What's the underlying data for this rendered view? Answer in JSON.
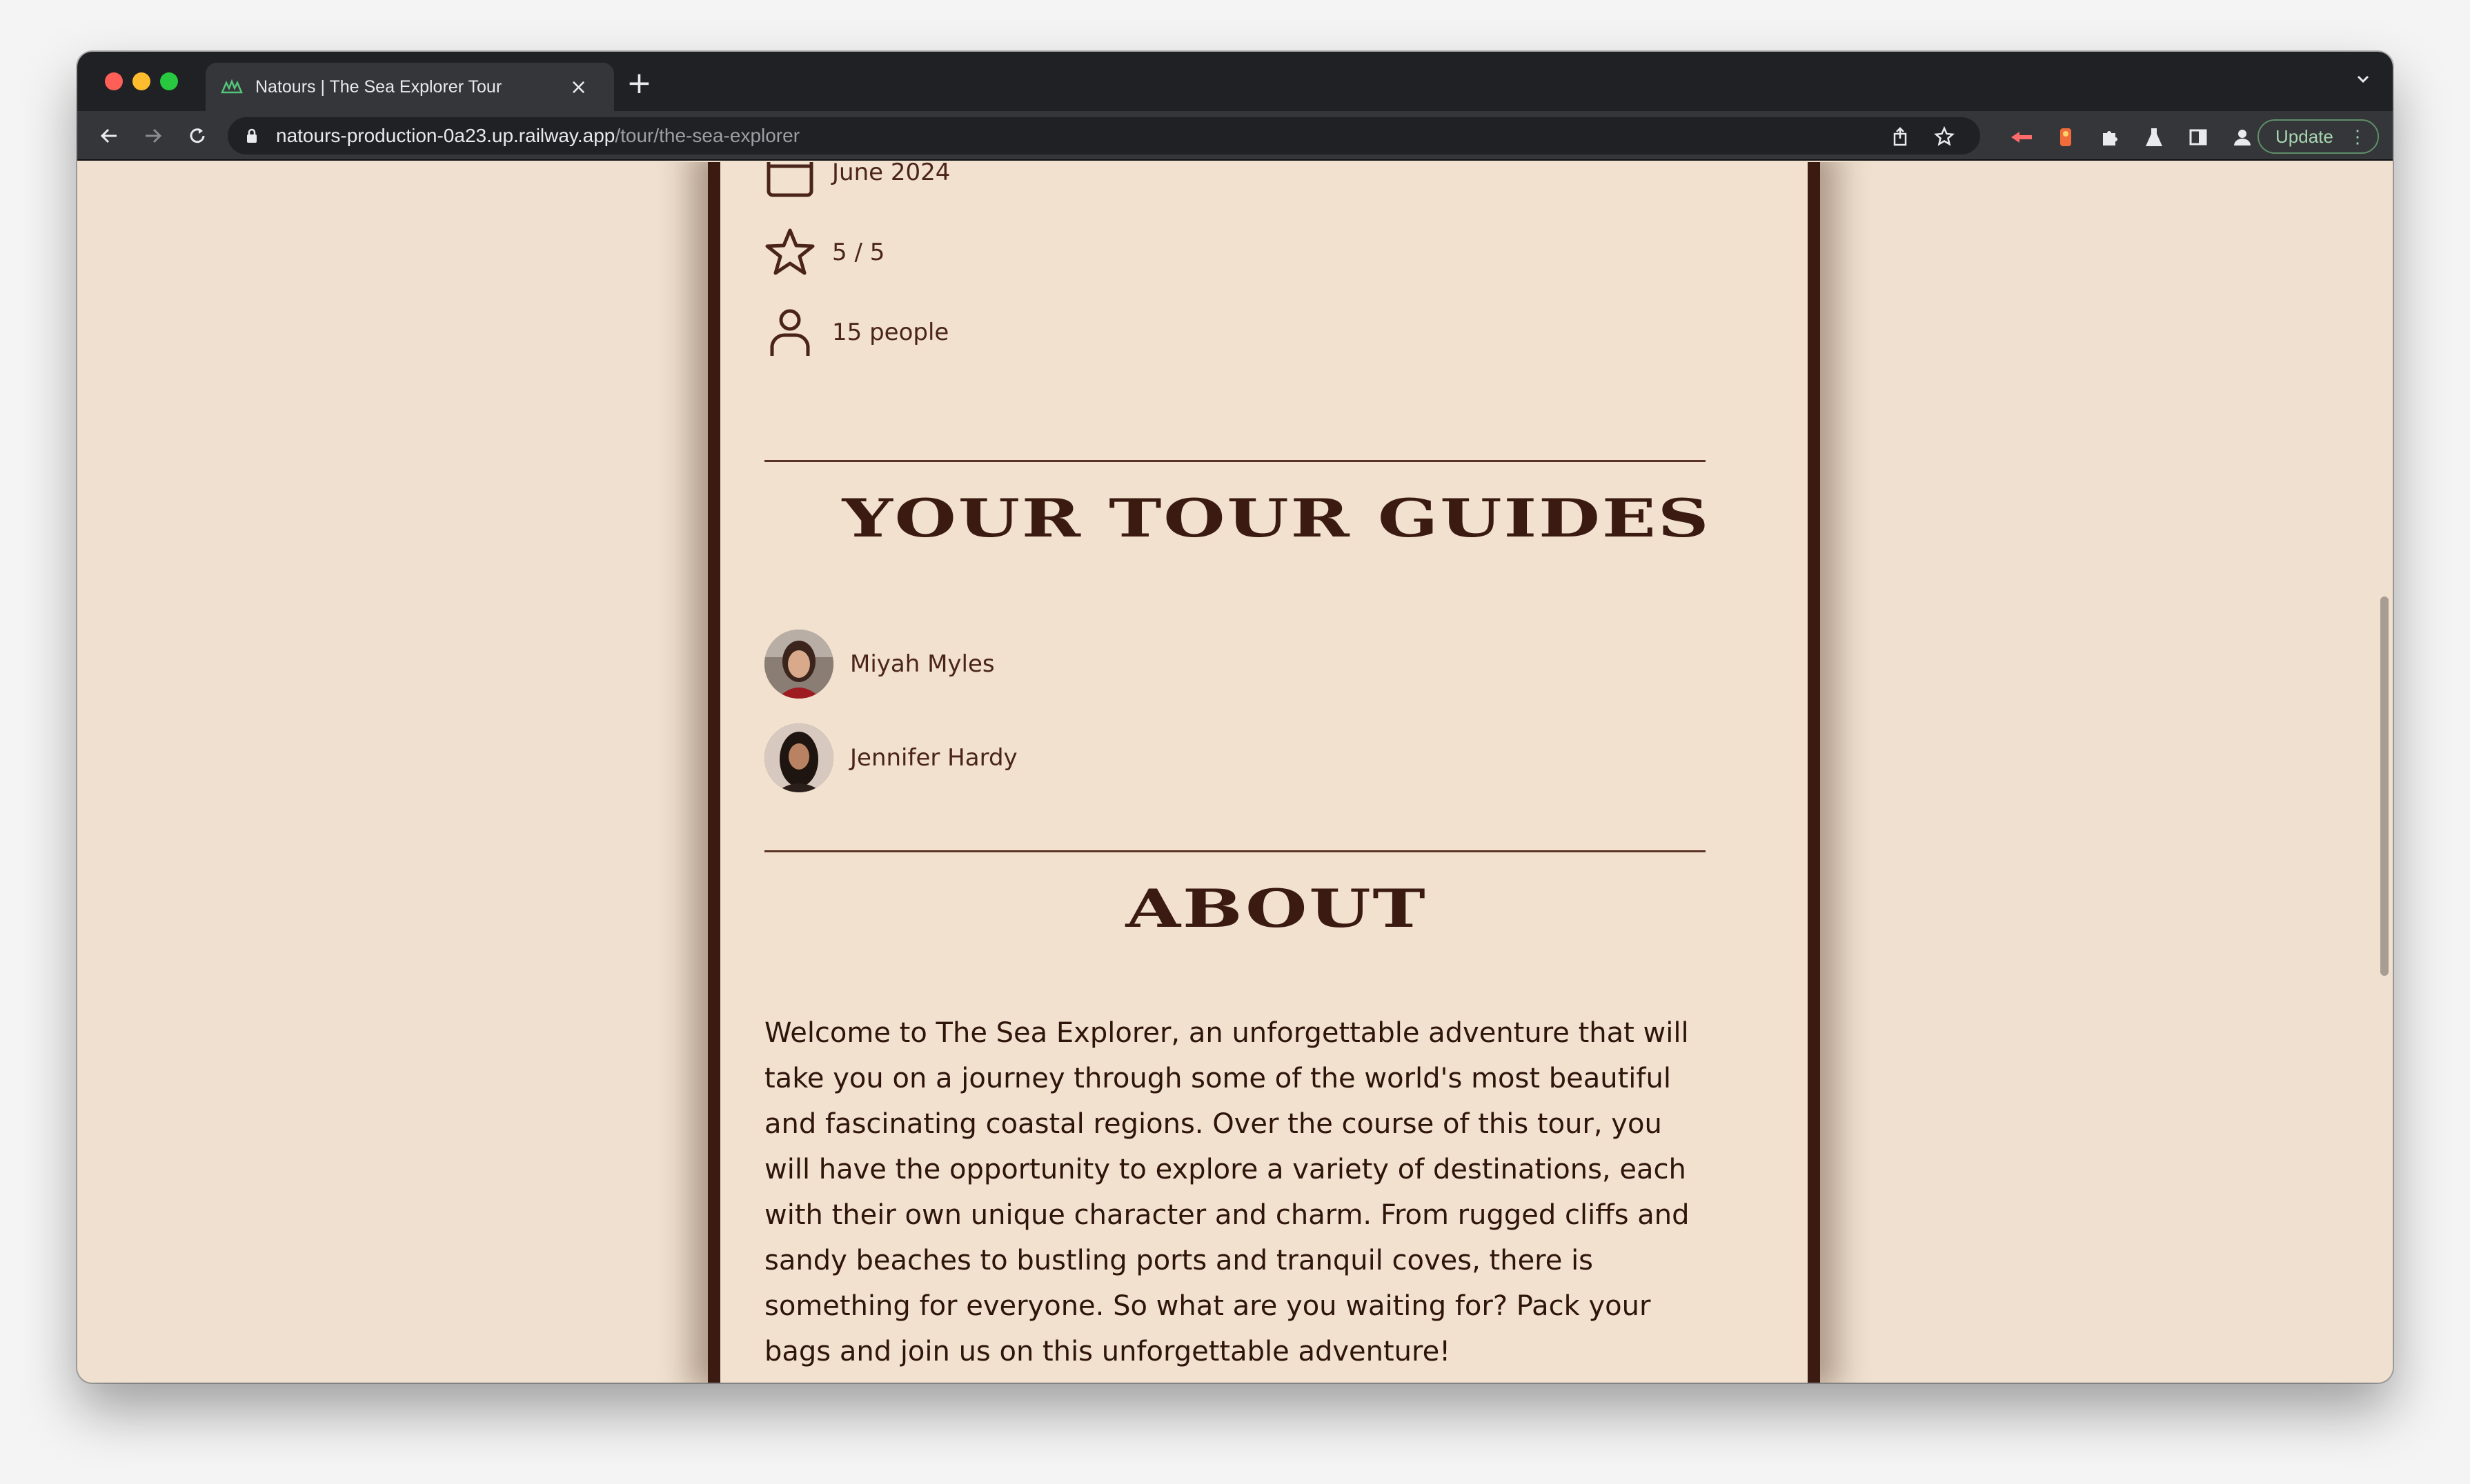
{
  "browser": {
    "tab_title": "Natours | The Sea Explorer Tour",
    "new_tab_label": "+",
    "url_host": "natours-production-0a23.up.railway.app",
    "url_path": "/tour/the-sea-explorer",
    "update_label": "Update",
    "icons": [
      "back-arrow-icon",
      "forward-arrow-icon",
      "reload-icon",
      "lock-icon",
      "share-icon",
      "star-bookmark-icon",
      "extension-icons",
      "puzzle-extensions-icon",
      "flask-icon",
      "sidebar-icon",
      "profile-icon",
      "kebab-menu-icon"
    ]
  },
  "facts": [
    {
      "icon": "calendar-icon",
      "text": "June 2024"
    },
    {
      "icon": "star-icon",
      "text": "5 / 5"
    },
    {
      "icon": "user-icon",
      "text": "15 people"
    }
  ],
  "guides_section": {
    "title": "YOUR TOUR GUIDES",
    "guides": [
      {
        "name": "Miyah Myles"
      },
      {
        "name": "Jennifer Hardy"
      }
    ]
  },
  "about_section": {
    "title": "ABOUT",
    "body": "Welcome to The Sea Explorer, an unforgettable adventure that will take you on a journey through some of the world's most beautiful and fascinating coastal regions. Over the course of this tour, you will have the opportunity to explore a variety of destinations, each with their own unique character and charm. From rugged cliffs and sandy beaches to bustling ports and tranquil coves, there is something for everyone. So what are you waiting for? Pack your bags and join us on this unforgettable adventure!"
  },
  "colors": {
    "page_bg": "#efe0cf",
    "card_border": "#3b1a12",
    "text_dark": "#2f140c",
    "text_brown": "#4a2418"
  }
}
